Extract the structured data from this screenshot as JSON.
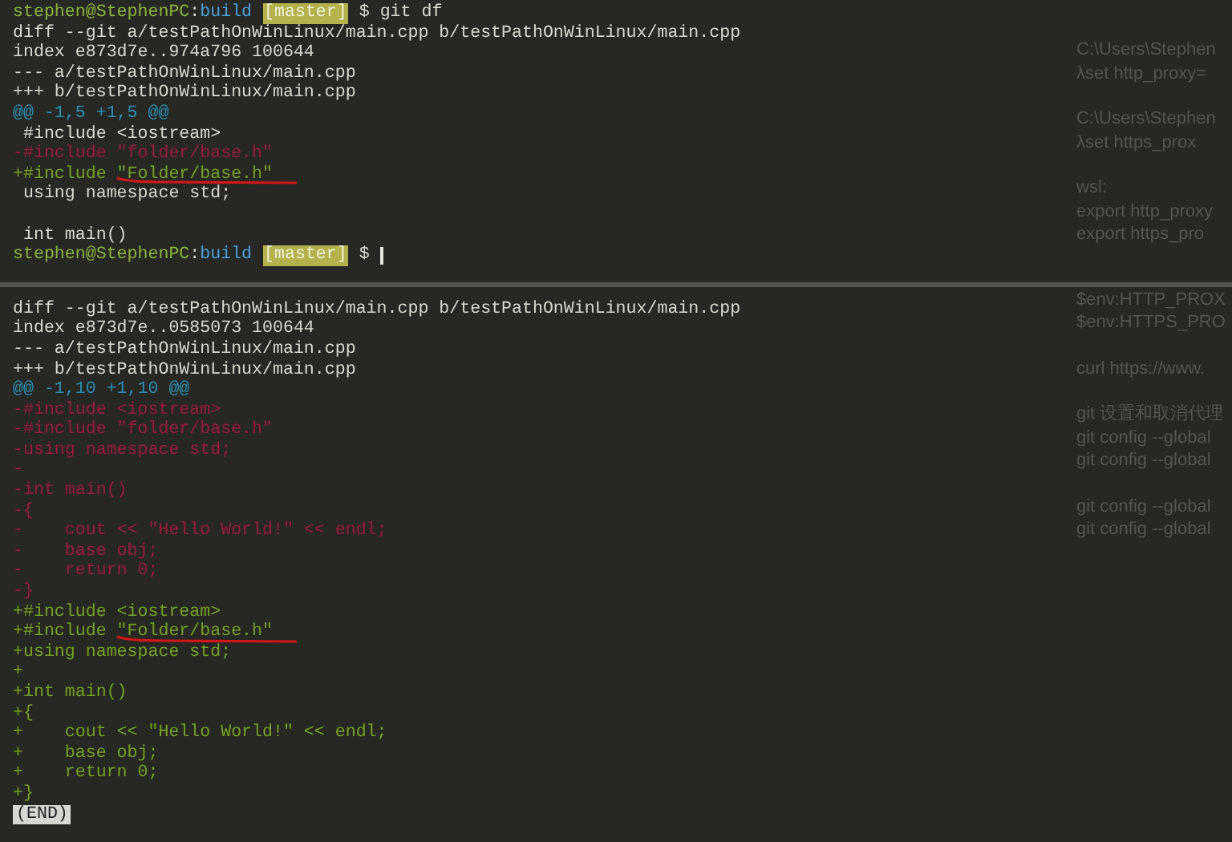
{
  "background_page": {
    "groups": [
      [
        "C:\\Users\\Stephen",
        "λset http_proxy="
      ],
      [
        "C:\\Users\\Stephen",
        "λset https_prox"
      ],
      [
        "wsl:",
        "export http_proxy",
        "export https_pro"
      ],
      [
        "$env:HTTP_PROX",
        "$env:HTTPS_PRO"
      ],
      [
        "curl https://www."
      ],
      [
        "git 设置和取消代理",
        "git config --global",
        "git config --global"
      ],
      [
        "git config --global",
        "git config --global"
      ]
    ]
  },
  "terminal": {
    "panes": [
      {
        "lines": [
          {
            "kind": "prompt",
            "user_host": "stephen@StephenPC",
            "separator": ":",
            "directory": "build",
            "branch": "[master]",
            "symbol": "$",
            "command": "git df",
            "cursor": false
          },
          {
            "kind": "meta",
            "text": "diff --git a/testPathOnWinLinux/main.cpp b/testPathOnWinLinux/main.cpp"
          },
          {
            "kind": "meta",
            "text": "index e873d7e..974a796 100644"
          },
          {
            "kind": "meta",
            "text": "--- a/testPathOnWinLinux/main.cpp"
          },
          {
            "kind": "meta",
            "text": "+++ b/testPathOnWinLinux/main.cpp"
          },
          {
            "kind": "hunk",
            "text": "@@ -1,5 +1,5 @@"
          },
          {
            "kind": "context",
            "text": " #include <iostream>"
          },
          {
            "kind": "removed",
            "text": "-#include \"folder/base.h\""
          },
          {
            "kind": "added",
            "text": "+#include \"Folder/base.h\"",
            "underlined": true
          },
          {
            "kind": "context",
            "text": " using namespace std;"
          },
          {
            "kind": "blank"
          },
          {
            "kind": "context",
            "text": " int main()"
          },
          {
            "kind": "prompt",
            "user_host": "stephen@StephenPC",
            "separator": ":",
            "directory": "build",
            "branch": "[master]",
            "symbol": "$",
            "cursor": true
          }
        ]
      },
      {
        "lines": [
          {
            "kind": "meta",
            "text": "diff --git a/testPathOnWinLinux/main.cpp b/testPathOnWinLinux/main.cpp"
          },
          {
            "kind": "meta",
            "text": "index e873d7e..0585073 100644"
          },
          {
            "kind": "meta",
            "text": "--- a/testPathOnWinLinux/main.cpp"
          },
          {
            "kind": "meta",
            "text": "+++ b/testPathOnWinLinux/main.cpp"
          },
          {
            "kind": "hunk",
            "text": "@@ -1,10 +1,10 @@"
          },
          {
            "kind": "removed",
            "text": "-#include <iostream>"
          },
          {
            "kind": "removed",
            "text": "-#include \"folder/base.h\""
          },
          {
            "kind": "removed",
            "text": "-using namespace std;"
          },
          {
            "kind": "removed",
            "text": "-"
          },
          {
            "kind": "removed",
            "text": "-int main()"
          },
          {
            "kind": "removed",
            "text": "-{"
          },
          {
            "kind": "removed",
            "text": "-    cout << \"Hello World!\" << endl;"
          },
          {
            "kind": "removed",
            "text": "-    base obj;"
          },
          {
            "kind": "removed",
            "text": "-    return 0;"
          },
          {
            "kind": "removed",
            "text": "-}"
          },
          {
            "kind": "added",
            "text": "+#include <iostream>"
          },
          {
            "kind": "added",
            "text": "+#include \"Folder/base.h\"",
            "underlined": true
          },
          {
            "kind": "added",
            "text": "+using namespace std;"
          },
          {
            "kind": "added",
            "text": "+"
          },
          {
            "kind": "added",
            "text": "+int main()"
          },
          {
            "kind": "added",
            "text": "+{"
          },
          {
            "kind": "added",
            "text": "+    cout << \"Hello World!\" << endl;"
          },
          {
            "kind": "added",
            "text": "+    base obj;"
          },
          {
            "kind": "added",
            "text": "+    return 0;"
          },
          {
            "kind": "added",
            "text": "+}"
          },
          {
            "kind": "pager",
            "text": "(END)"
          }
        ]
      }
    ]
  }
}
